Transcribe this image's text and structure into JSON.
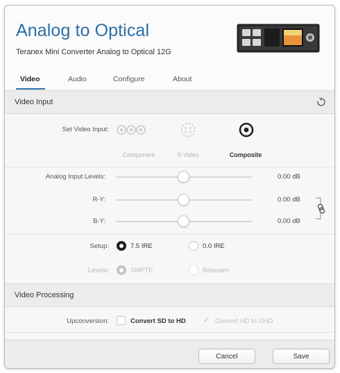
{
  "header": {
    "title": "Analog to Optical",
    "subtitle": "Teranex Mini Converter Analog to Optical 12G"
  },
  "tabs": [
    {
      "label": "Video",
      "active": true
    },
    {
      "label": "Audio",
      "active": false
    },
    {
      "label": "Configure",
      "active": false
    },
    {
      "label": "About",
      "active": false
    }
  ],
  "video_input": {
    "section_title": "Video Input",
    "set_input_label": "Set Video Input:",
    "options": [
      {
        "label": "Component",
        "selected": false,
        "icon": "component-rca-icon"
      },
      {
        "label": "S-Video",
        "selected": false,
        "icon": "s-video-connector-icon"
      },
      {
        "label": "Composite",
        "selected": true,
        "icon": "composite-rca-icon"
      }
    ],
    "levels_label": "Analog Input Levels:",
    "sliders": [
      {
        "label": "",
        "value_text": "0.00 dB",
        "position": 0.5
      },
      {
        "label": "R-Y:",
        "value_text": "0.00 dB",
        "position": 0.5
      },
      {
        "label": "B-Y:",
        "value_text": "0.00 dB",
        "position": 0.5
      }
    ],
    "setup": {
      "label": "Setup:",
      "options": [
        {
          "label": "7.5 IRE",
          "selected": true
        },
        {
          "label": "0.0 IRE",
          "selected": false
        }
      ]
    },
    "levels": {
      "label": "Levels:",
      "options": [
        {
          "label": "SMPTE",
          "selected": true
        },
        {
          "label": "Betacam",
          "selected": false
        }
      ]
    }
  },
  "video_processing": {
    "section_title": "Video Processing",
    "upconversion_label": "Upconversion:",
    "options": [
      {
        "label": "Convert SD to HD",
        "checked": false,
        "enabled": true
      },
      {
        "label": "Convert HD to UHD",
        "checked": true,
        "enabled": false
      }
    ]
  },
  "footer": {
    "cancel_label": "Cancel",
    "save_label": "Save"
  },
  "colors": {
    "accent": "#2b6ea6",
    "selected": "#1f1f1f",
    "disabled": "#c4c4c4"
  }
}
